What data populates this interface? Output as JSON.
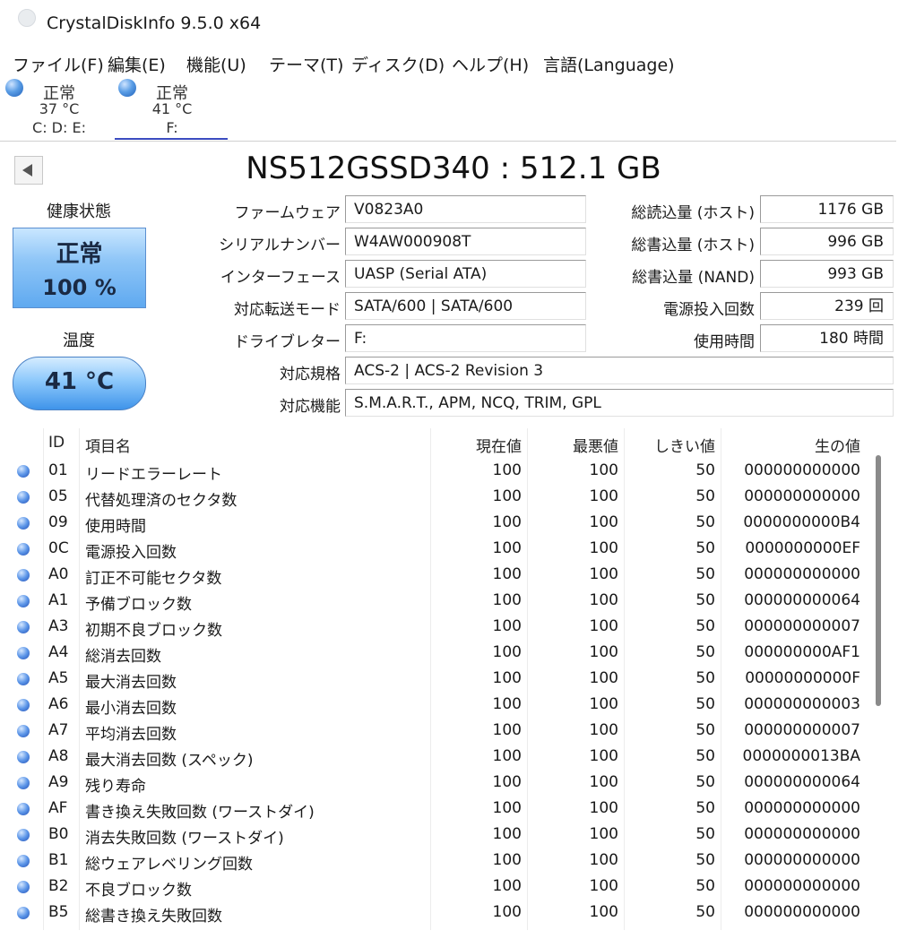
{
  "window": {
    "title": "CrystalDiskInfo 9.5.0 x64"
  },
  "menu": [
    "ファイル(F)",
    "編集(E)",
    "機能(U)",
    "テーマ(T)",
    "ディスク(D)",
    "ヘルプ(H)",
    "言語(Language)"
  ],
  "disks": [
    {
      "status": "正常",
      "temp": "37 °C",
      "drives": "C: D: E:"
    },
    {
      "status": "正常",
      "temp": "41 °C",
      "drives": "F:"
    }
  ],
  "model": "NS512GSSD340 : 512.1 GB",
  "health": {
    "label": "健康状態",
    "status": "正常",
    "percent": "100 %"
  },
  "temperature": {
    "label": "温度",
    "value": "41 °C"
  },
  "info": {
    "firmware_label": "ファームウェア",
    "firmware": "V0823A0",
    "serial_label": "シリアルナンバー",
    "serial": "W4AW000908T",
    "interface_label": "インターフェース",
    "interface": "UASP (Serial ATA)",
    "transfer_label": "対応転送モード",
    "transfer": "SATA/600 | SATA/600",
    "drive_letter_label": "ドライブレター",
    "drive_letter": "F:",
    "standard_label": "対応規格",
    "standard": "ACS-2 | ACS-2 Revision 3",
    "features_label": "対応機能",
    "features": "S.M.A.R.T., APM, NCQ, TRIM, GPL",
    "host_reads_label": "総読込量 (ホスト)",
    "host_reads": "1176 GB",
    "host_writes_label": "総書込量 (ホスト)",
    "host_writes": "996 GB",
    "nand_writes_label": "総書込量 (NAND)",
    "nand_writes": "993 GB",
    "power_count_label": "電源投入回数",
    "power_count": "239 回",
    "power_hours_label": "使用時間",
    "power_hours": "180 時間"
  },
  "smart": {
    "headers": {
      "id": "ID",
      "name": "項目名",
      "current": "現在値",
      "worst": "最悪値",
      "threshold": "しきい値",
      "raw": "生の値"
    },
    "rows": [
      {
        "id": "01",
        "name": "リードエラーレート",
        "current": "100",
        "worst": "100",
        "threshold": "50",
        "raw": "000000000000"
      },
      {
        "id": "05",
        "name": "代替処理済のセクタ数",
        "current": "100",
        "worst": "100",
        "threshold": "50",
        "raw": "000000000000"
      },
      {
        "id": "09",
        "name": "使用時間",
        "current": "100",
        "worst": "100",
        "threshold": "50",
        "raw": "0000000000B4"
      },
      {
        "id": "0C",
        "name": "電源投入回数",
        "current": "100",
        "worst": "100",
        "threshold": "50",
        "raw": "0000000000EF"
      },
      {
        "id": "A0",
        "name": "訂正不可能セクタ数",
        "current": "100",
        "worst": "100",
        "threshold": "50",
        "raw": "000000000000"
      },
      {
        "id": "A1",
        "name": "予備ブロック数",
        "current": "100",
        "worst": "100",
        "threshold": "50",
        "raw": "000000000064"
      },
      {
        "id": "A3",
        "name": "初期不良ブロック数",
        "current": "100",
        "worst": "100",
        "threshold": "50",
        "raw": "000000000007"
      },
      {
        "id": "A4",
        "name": "総消去回数",
        "current": "100",
        "worst": "100",
        "threshold": "50",
        "raw": "000000000AF1"
      },
      {
        "id": "A5",
        "name": "最大消去回数",
        "current": "100",
        "worst": "100",
        "threshold": "50",
        "raw": "00000000000F"
      },
      {
        "id": "A6",
        "name": "最小消去回数",
        "current": "100",
        "worst": "100",
        "threshold": "50",
        "raw": "000000000003"
      },
      {
        "id": "A7",
        "name": "平均消去回数",
        "current": "100",
        "worst": "100",
        "threshold": "50",
        "raw": "000000000007"
      },
      {
        "id": "A8",
        "name": "最大消去回数 (スペック)",
        "current": "100",
        "worst": "100",
        "threshold": "50",
        "raw": "0000000013BA"
      },
      {
        "id": "A9",
        "name": "残り寿命",
        "current": "100",
        "worst": "100",
        "threshold": "50",
        "raw": "000000000064"
      },
      {
        "id": "AF",
        "name": "書き換え失敗回数 (ワーストダイ)",
        "current": "100",
        "worst": "100",
        "threshold": "50",
        "raw": "000000000000"
      },
      {
        "id": "B0",
        "name": "消去失敗回数 (ワーストダイ)",
        "current": "100",
        "worst": "100",
        "threshold": "50",
        "raw": "000000000000"
      },
      {
        "id": "B1",
        "name": "総ウェアレベリング回数",
        "current": "100",
        "worst": "100",
        "threshold": "50",
        "raw": "000000000000"
      },
      {
        "id": "B2",
        "name": "不良ブロック数",
        "current": "100",
        "worst": "100",
        "threshold": "50",
        "raw": "000000000000"
      },
      {
        "id": "B5",
        "name": "総書き換え失敗回数",
        "current": "100",
        "worst": "100",
        "threshold": "50",
        "raw": "000000000000"
      }
    ]
  }
}
